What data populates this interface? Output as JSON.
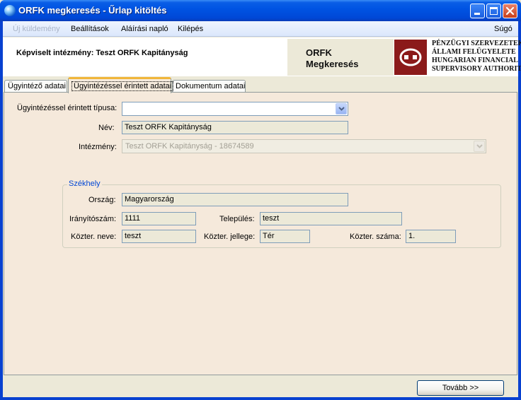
{
  "window": {
    "title": "ORFK megkeresés - Űrlap kitöltés"
  },
  "menu": {
    "new_message": "Új küldemény",
    "settings": "Beállítások",
    "signature_log": "Aláírási napló",
    "exit": "Kilépés",
    "help": "Súgó"
  },
  "header": {
    "institution_label": "Képviselt intézmény: Teszt ORFK Kapitányság",
    "orfk_title": "ORFK\nMegkeresés",
    "logo_text": "PÉNZÜGYI SZERVEZETEK\nÁLLAMI FELÜGYELETE\nHUNGARIAN FINANCIAL\nSUPERVISORY AUTHORITY"
  },
  "tabs": [
    {
      "label": "Ügyintéző adatai"
    },
    {
      "label": "Ügyintézéssel érintett adatai"
    },
    {
      "label": "Dokumentum adatai"
    }
  ],
  "form": {
    "type_label": "Ügyintézéssel érintett típusa:",
    "type_value": "",
    "name_label": "Név:",
    "name_value": "Teszt ORFK Kapitányság",
    "institution_label": "Intézmény:",
    "institution_value": "Teszt ORFK Kapitányság - 18674589",
    "seat_group_title": "Székhely",
    "country_label": "Ország:",
    "country_value": "Magyarország",
    "zip_label": "Irányítószám:",
    "zip_value": "1111",
    "city_label": "Település:",
    "city_value": "teszt",
    "street_name_label": "Közter. neve:",
    "street_name_value": "teszt",
    "street_type_label": "Közter. jellege:",
    "street_type_value": "Tér",
    "street_number_label": "Közter. száma:",
    "street_number_value": "1."
  },
  "footer": {
    "next_button": "Tovább >>"
  }
}
